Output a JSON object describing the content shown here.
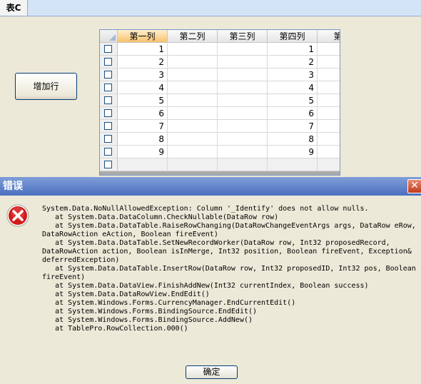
{
  "tab": {
    "label": "表C"
  },
  "add_row_button": {
    "label": "增加行"
  },
  "grid": {
    "columns": [
      "第一列",
      "第二列",
      "第三列",
      "第四列",
      "第三"
    ],
    "rows": [
      [
        "1",
        "",
        "",
        "1",
        ""
      ],
      [
        "2",
        "",
        "",
        "2",
        ""
      ],
      [
        "3",
        "",
        "",
        "3",
        ""
      ],
      [
        "4",
        "",
        "",
        "4",
        ""
      ],
      [
        "5",
        "",
        "",
        "5",
        ""
      ],
      [
        "6",
        "",
        "",
        "6",
        ""
      ],
      [
        "7",
        "",
        "",
        "7",
        ""
      ],
      [
        "8",
        "",
        "",
        "8",
        ""
      ],
      [
        "9",
        "",
        "",
        "9",
        ""
      ]
    ]
  },
  "dialog": {
    "title": "错误",
    "close_glyph": "✕",
    "icon": "error-icon",
    "message": "System.Data.NoNullAllowedException: Column '_Identify' does not allow nulls.\n   at System.Data.DataColumn.CheckNullable(DataRow row)\n   at System.Data.DataTable.RaiseRowChanging(DataRowChangeEventArgs args, DataRow eRow,\nDataRowAction eAction, Boolean fireEvent)\n   at System.Data.DataTable.SetNewRecordWorker(DataRow row, Int32 proposedRecord,\nDataRowAction action, Boolean isInMerge, Int32 position, Boolean fireEvent, Exception&\ndeferredException)\n   at System.Data.DataTable.InsertRow(DataRow row, Int32 proposedID, Int32 pos, Boolean\nfireEvent)\n   at System.Data.DataView.FinishAddNew(Int32 currentIndex, Boolean success)\n   at System.Data.DataRowView.EndEdit()\n   at System.Windows.Forms.CurrencyManager.EndCurrentEdit()\n   at System.Windows.Forms.BindingSource.EndEdit()\n   at System.Windows.Forms.BindingSource.AddNew()\n   at TablePro.RowCollection.000()",
    "ok_label": "确定"
  },
  "colors": {
    "title_bar": "#4b6fc0",
    "header_selected": "#f8c16d",
    "error_red": "#c8102e"
  }
}
